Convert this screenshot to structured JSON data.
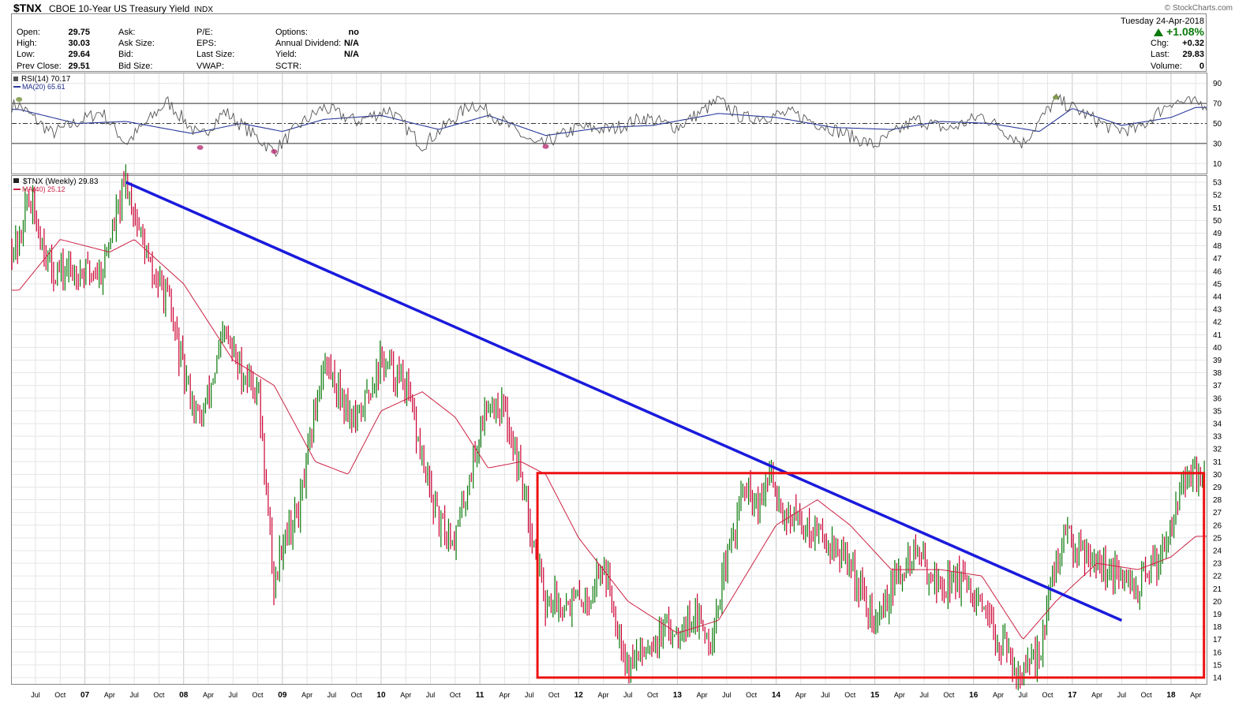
{
  "header": {
    "symbol": "$TNX",
    "name": "CBOE 10-Year US Treasury Yield",
    "exchange": "INDX",
    "brand": "© StockCharts.com",
    "date": "Tuesday  24-Apr-2018",
    "change_pct": "+1.08%",
    "stats_left": [
      {
        "label": "Open:",
        "value": "29.75"
      },
      {
        "label": "High:",
        "value": "30.03"
      },
      {
        "label": "Low:",
        "value": "29.64"
      },
      {
        "label": "Prev Close:",
        "value": "29.51"
      }
    ],
    "stats_mid": [
      {
        "label": "Ask:",
        "value": ""
      },
      {
        "label": "Ask Size:",
        "value": ""
      },
      {
        "label": "Bid:",
        "value": ""
      },
      {
        "label": "Bid Size:",
        "value": ""
      }
    ],
    "stats_mid2": [
      {
        "label": "P/E:",
        "value": ""
      },
      {
        "label": "EPS:",
        "value": ""
      },
      {
        "label": "Last Size:",
        "value": ""
      },
      {
        "label": "VWAP:",
        "value": ""
      }
    ],
    "stats_right": [
      {
        "label": "Options:",
        "value": "no"
      },
      {
        "label": "Annual Dividend:",
        "value": "N/A"
      },
      {
        "label": "Yield:",
        "value": "N/A"
      },
      {
        "label": "SCTR:",
        "value": ""
      }
    ],
    "stats_far": [
      {
        "label": "Chg:",
        "value": "+0.32"
      },
      {
        "label": "Last:",
        "value": "29.83"
      },
      {
        "label": "Volume:",
        "value": "0"
      }
    ]
  },
  "chart_data": [
    {
      "type": "line",
      "panel": "indicator",
      "legend": [
        "RSI(14) 70.17",
        "MA(20) 65.61"
      ],
      "ylim": [
        0,
        100
      ],
      "ticks": [
        "90",
        "70",
        "50",
        "30",
        "10"
      ],
      "tick_values": [
        90,
        70,
        50,
        30,
        10
      ],
      "reference_lines": [
        70,
        50,
        30
      ],
      "colors": {
        "rsi": "#555555",
        "ma": "#2a3a9c",
        "overbought": "#6b8a2a",
        "oversold": "#b0236c"
      },
      "series": [
        {
          "name": "RSI(14) 70.17",
          "x": [
            "2006-05",
            "2006-09",
            "2007-03",
            "2007-06",
            "2007-11",
            "2008-03",
            "2008-06",
            "2008-12",
            "2009-03",
            "2009-06",
            "2009-10",
            "2010-02",
            "2010-06",
            "2010-12",
            "2011-02",
            "2011-08",
            "2012-01",
            "2012-05",
            "2012-09",
            "2013-01",
            "2013-06",
            "2013-09",
            "2014-03",
            "2014-08",
            "2015-01",
            "2015-06",
            "2015-10",
            "2016-02",
            "2016-07",
            "2016-11",
            "2017-01",
            "2017-06",
            "2017-09",
            "2018-01",
            "2018-04"
          ],
          "y": [
            68,
            40,
            62,
            30,
            72,
            36,
            62,
            22,
            48,
            66,
            52,
            64,
            28,
            70,
            62,
            27,
            46,
            44,
            56,
            46,
            73,
            55,
            60,
            44,
            28,
            54,
            44,
            58,
            30,
            74,
            66,
            44,
            44,
            72,
            70
          ]
        },
        {
          "name": "MA(20) 65.61",
          "x": [
            "2006-05",
            "2006-12",
            "2007-06",
            "2008-02",
            "2008-08",
            "2009-01",
            "2009-06",
            "2010-01",
            "2010-08",
            "2011-02",
            "2011-09",
            "2012-04",
            "2012-10",
            "2013-06",
            "2014-01",
            "2014-08",
            "2015-03",
            "2015-09",
            "2016-03",
            "2016-09",
            "2017-01",
            "2017-07",
            "2018-01",
            "2018-04"
          ],
          "y": [
            64,
            50,
            52,
            40,
            50,
            42,
            54,
            58,
            44,
            58,
            38,
            46,
            48,
            60,
            56,
            46,
            44,
            52,
            50,
            42,
            65,
            48,
            56,
            66
          ]
        }
      ]
    },
    {
      "type": "line",
      "panel": "price",
      "legend": [
        "$TNX (Weekly) 29.83",
        "MA(40) 25.12"
      ],
      "ylim": [
        13.5,
        53.5
      ],
      "y_ticks": [
        53,
        52,
        51,
        50,
        49,
        48,
        47,
        46,
        45,
        44,
        43,
        42,
        41,
        40,
        39,
        38,
        37,
        36,
        35,
        34,
        33,
        32,
        31,
        30,
        29,
        28,
        27,
        26,
        25,
        24,
        23,
        22,
        21,
        20,
        19,
        18,
        17,
        16,
        15,
        14
      ],
      "x_ticks": [
        "Jul",
        "Oct",
        "07",
        "Apr",
        "Jul",
        "Oct",
        "08",
        "Apr",
        "Jul",
        "Oct",
        "09",
        "Apr",
        "Jul",
        "Oct",
        "10",
        "Apr",
        "Jul",
        "Oct",
        "11",
        "Apr",
        "Jul",
        "Oct",
        "12",
        "Apr",
        "Jul",
        "Oct",
        "13",
        "Apr",
        "Jul",
        "Oct",
        "14",
        "Apr",
        "Jul",
        "Oct",
        "15",
        "Apr",
        "Jul",
        "Oct",
        "16",
        "Apr",
        "Jul",
        "Oct",
        "17",
        "Apr",
        "Jul",
        "Oct",
        "18",
        "Apr"
      ],
      "x_tick_dates": [
        "2006-07",
        "2006-10",
        "2007-01",
        "2007-04",
        "2007-07",
        "2007-10",
        "2008-01",
        "2008-04",
        "2008-07",
        "2008-10",
        "2009-01",
        "2009-04",
        "2009-07",
        "2009-10",
        "2010-01",
        "2010-04",
        "2010-07",
        "2010-10",
        "2011-01",
        "2011-04",
        "2011-07",
        "2011-10",
        "2012-01",
        "2012-04",
        "2012-07",
        "2012-10",
        "2013-01",
        "2013-04",
        "2013-07",
        "2013-10",
        "2014-01",
        "2014-04",
        "2014-07",
        "2014-10",
        "2015-01",
        "2015-04",
        "2015-07",
        "2015-10",
        "2016-01",
        "2016-04",
        "2016-07",
        "2016-10",
        "2017-01",
        "2017-04",
        "2017-07",
        "2017-10",
        "2018-01",
        "2018-04"
      ],
      "colors": {
        "up": "#0a7a0a",
        "down": "#cc0033",
        "ma": "#cc2244",
        "trendline": "#1a1adc",
        "range_box": "#ee1111"
      },
      "series": [
        {
          "name": "$TNX (Weekly) 29.83",
          "x": [
            "2006-05",
            "2006-06",
            "2006-09",
            "2006-12",
            "2007-03",
            "2007-06",
            "2007-09",
            "2007-11",
            "2008-01",
            "2008-03",
            "2008-06",
            "2008-08",
            "2008-10",
            "2008-12",
            "2009-01",
            "2009-03",
            "2009-06",
            "2009-10",
            "2010-01",
            "2010-04",
            "2010-06",
            "2010-08",
            "2010-10",
            "2011-02",
            "2011-04",
            "2011-06",
            "2011-09",
            "2011-12",
            "2012-02",
            "2012-04",
            "2012-07",
            "2012-10",
            "2013-01",
            "2013-03",
            "2013-05",
            "2013-09",
            "2013-11",
            "2013-12",
            "2014-02",
            "2014-07",
            "2014-10",
            "2015-01",
            "2015-03",
            "2015-06",
            "2015-09",
            "2015-11",
            "2016-01",
            "2016-03",
            "2016-07",
            "2016-09",
            "2016-11",
            "2016-12",
            "2017-03",
            "2017-06",
            "2017-09",
            "2017-12",
            "2018-02",
            "2018-04"
          ],
          "y": [
            48,
            52,
            46,
            46,
            46,
            53,
            46,
            44,
            38,
            34,
            41,
            38,
            37,
            21,
            25,
            27,
            39,
            34,
            39,
            37,
            31,
            26,
            25,
            36,
            35,
            30,
            20,
            20,
            20,
            23,
            15,
            17,
            18,
            19,
            17,
            29,
            27,
            30,
            27,
            25,
            23,
            18,
            21,
            24,
            21,
            22,
            20,
            18,
            14,
            16,
            23,
            25,
            24,
            22,
            21,
            24,
            29,
            29.83
          ]
        },
        {
          "name": "MA(40) 25.12",
          "x": [
            "2006-05",
            "2006-10",
            "2007-04",
            "2007-07",
            "2008-01",
            "2008-07",
            "2008-12",
            "2009-05",
            "2009-09",
            "2010-01",
            "2010-06",
            "2010-10",
            "2011-02",
            "2011-06",
            "2011-09",
            "2012-01",
            "2012-07",
            "2013-01",
            "2013-06",
            "2014-01",
            "2014-06",
            "2014-10",
            "2015-03",
            "2015-09",
            "2016-02",
            "2016-07",
            "2016-11",
            "2017-04",
            "2017-09",
            "2018-01",
            "2018-04"
          ],
          "y": [
            44.5,
            48.5,
            47.5,
            48.5,
            45,
            39,
            37,
            31,
            30,
            35,
            36.5,
            34.5,
            30.5,
            31,
            30,
            25,
            20,
            17.5,
            18.5,
            26,
            28,
            26,
            22.5,
            22.5,
            22,
            17,
            20,
            23,
            22.5,
            23.5,
            25.12
          ]
        }
      ],
      "annotations": {
        "trendline": {
          "from": {
            "x": "2007-06",
            "y": 53
          },
          "to": {
            "x": "2017-07",
            "y": 18.5
          }
        },
        "range_box": {
          "x_from": "2011-08",
          "x_to": "2018-05",
          "y_from": 14,
          "y_to": 30.1
        }
      }
    }
  ]
}
